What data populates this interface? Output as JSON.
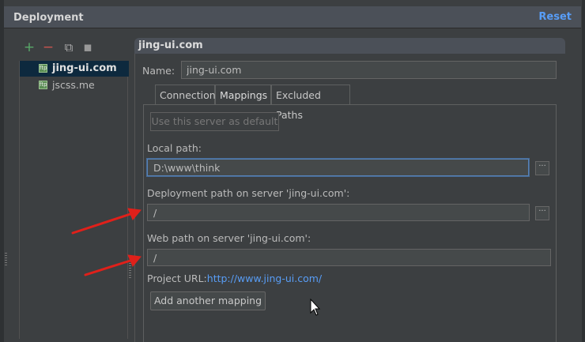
{
  "header": {
    "title": "Deployment",
    "reset_label": "Reset"
  },
  "toolbar": {
    "items": [
      {
        "icon": "plus-icon",
        "glyph": "+",
        "color": "#59a869"
      },
      {
        "icon": "minus-icon",
        "glyph": "−",
        "color": "#c75450"
      },
      {
        "icon": "copy-icon",
        "glyph": "⧉",
        "color": "#aaaaaa"
      },
      {
        "icon": "server-icon",
        "glyph": "▪",
        "color": "#999999"
      }
    ]
  },
  "servers": [
    {
      "label": "jing-ui.com",
      "selected": true
    },
    {
      "label": "jscss.me",
      "selected": false
    }
  ],
  "panel": {
    "title": "jing-ui.com",
    "name_label": "Name:",
    "name_value": "jing-ui.com",
    "tabs": [
      "Connection",
      "Mappings",
      "Excluded Paths"
    ],
    "active_tab": "Mappings",
    "default_button": "Use this server as default",
    "local_path_label": "Local path:",
    "local_path_value": "D:\\www\\think",
    "deploy_path_label": "Deployment path on server 'jing-ui.com':",
    "deploy_path_value": "/",
    "web_path_label": "Web path on server 'jing-ui.com':",
    "web_path_value": "/",
    "project_url_label": "Project URL:",
    "project_url_value": "http://www.jing-ui.com/",
    "add_mapping_button": "Add another mapping",
    "browse_glyph": "···"
  },
  "colors": {
    "accent": "#589df6",
    "selection": "#0d293e",
    "annotation_arrow": "#e0201a"
  }
}
